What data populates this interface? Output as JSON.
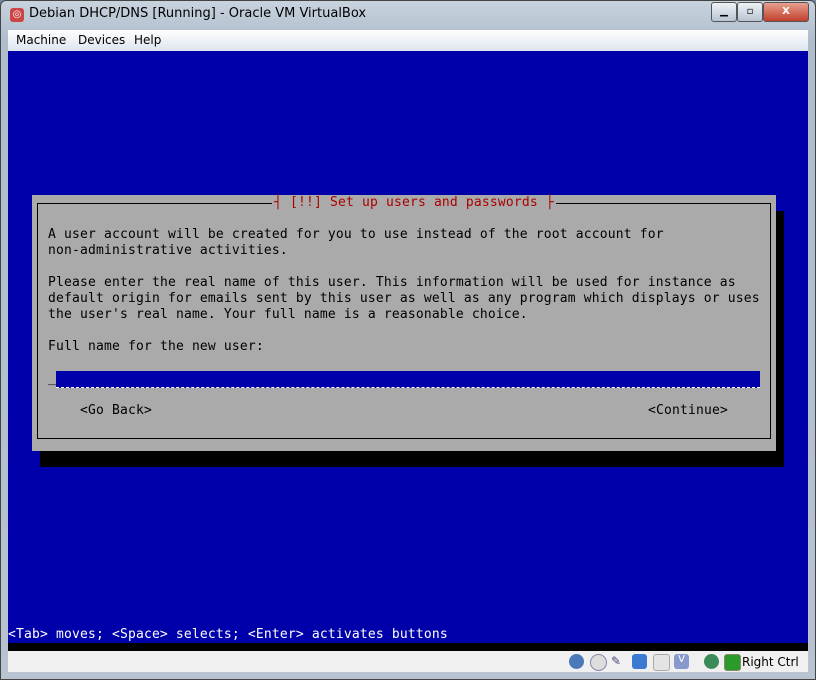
{
  "window": {
    "title": "Debian DHCP/DNS [Running] - Oracle VM VirtualBox",
    "controls": [
      "minimize",
      "restore",
      "close"
    ]
  },
  "menu": [
    "Machine",
    "Devices",
    "Help"
  ],
  "dialog": {
    "title": "[!!] Set up users and passwords",
    "lines": [
      "A user account will be created for you to use instead of the root account for",
      "non-administrative activities.",
      "Please enter the real name of this user. This information will be used for instance as",
      "default origin for emails sent by this user as well as any program which displays or uses",
      "the user's real name. Your full name is a reasonable choice."
    ],
    "field_label": "Full name for the new user:",
    "field_value": "",
    "go_back": "<Go Back>",
    "continue": "<Continue>"
  },
  "help_line": "<Tab> moves; <Space> selects; <Enter> activates buttons",
  "statusbar": {
    "icons": [
      "hard-disk-icon",
      "cd-icon",
      "usb-icon",
      "network-icon",
      "shared-folder-icon",
      "vrde-icon",
      "mouse-integration-icon",
      "keyboard-capture-icon"
    ],
    "host_key": "Right Ctrl"
  },
  "colors": {
    "screen": "#0000aa",
    "dialog": "#aaaaaa",
    "title": "#aa0000"
  }
}
